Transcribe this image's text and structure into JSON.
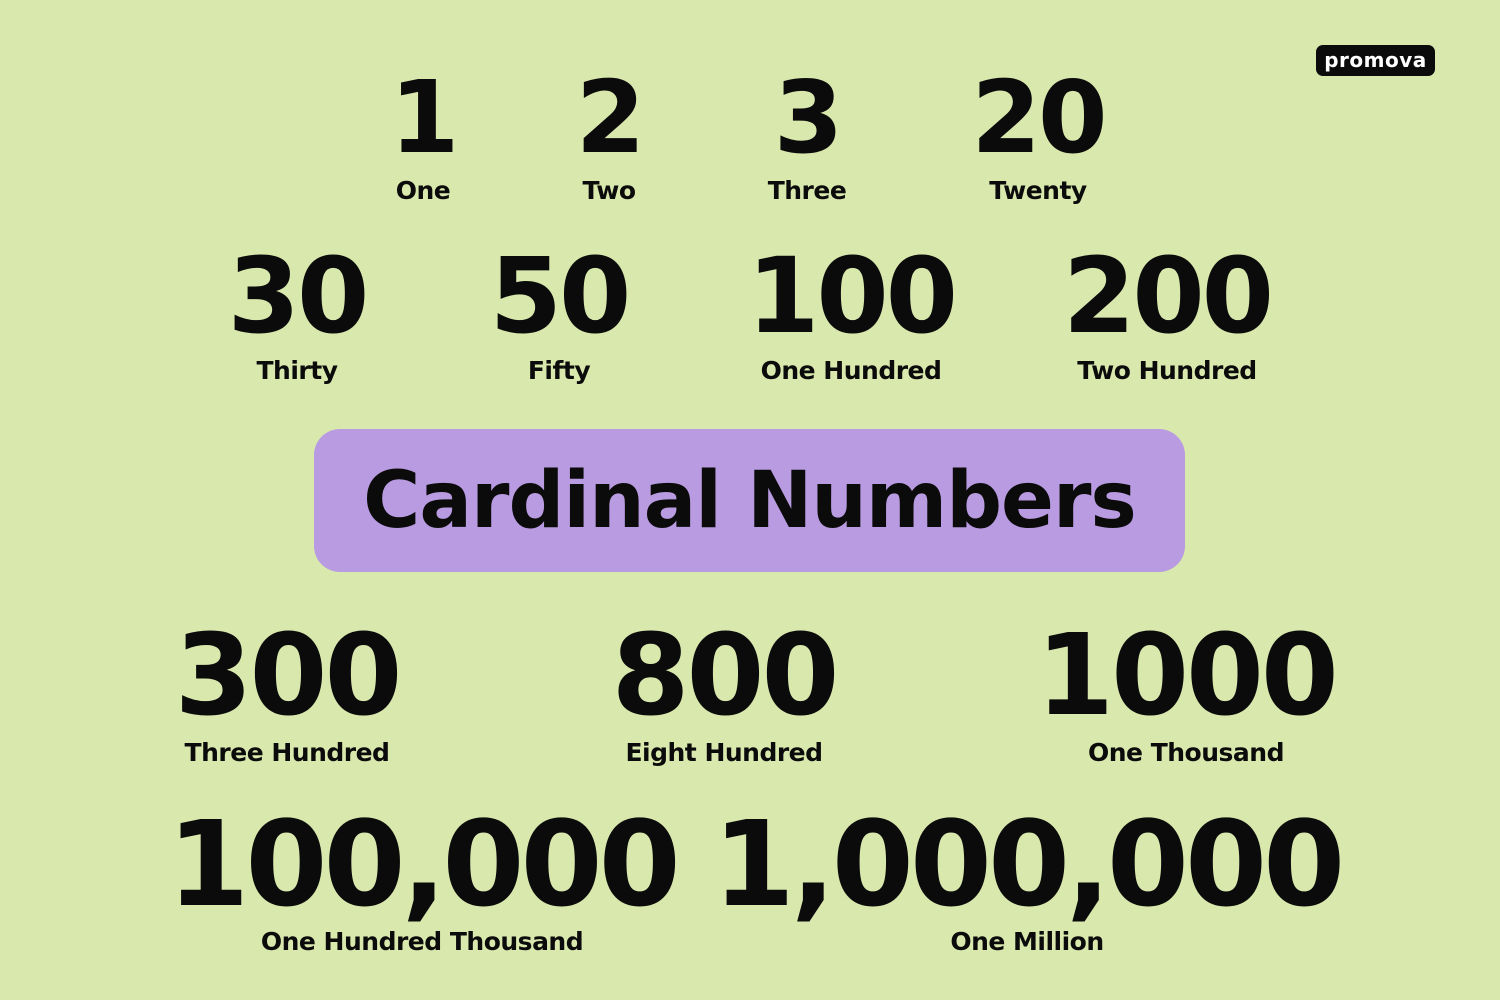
{
  "brand": {
    "logo_text": "promova"
  },
  "title": "Cardinal Numbers",
  "numbers": [
    {
      "numeral": "1",
      "word": "One"
    },
    {
      "numeral": "2",
      "word": "Two"
    },
    {
      "numeral": "3",
      "word": "Three"
    },
    {
      "numeral": "20",
      "word": "Twenty"
    },
    {
      "numeral": "30",
      "word": "Thirty"
    },
    {
      "numeral": "50",
      "word": "Fifty"
    },
    {
      "numeral": "100",
      "word": "One Hundred"
    },
    {
      "numeral": "200",
      "word": "Two Hundred"
    },
    {
      "numeral": "300",
      "word": "Three Hundred"
    },
    {
      "numeral": "800",
      "word": "Eight Hundred"
    },
    {
      "numeral": "1000",
      "word": "One Thousand"
    },
    {
      "numeral": "100,000",
      "word": "One Hundred Thousand"
    },
    {
      "numeral": "1,000,000",
      "word": "One Million"
    }
  ],
  "colors": {
    "background": "#d9e8ad",
    "title_box": "#b99be1",
    "text": "#0b0b0b",
    "logo_background": "#0b0b0b",
    "logo_text": "#ffffff"
  }
}
